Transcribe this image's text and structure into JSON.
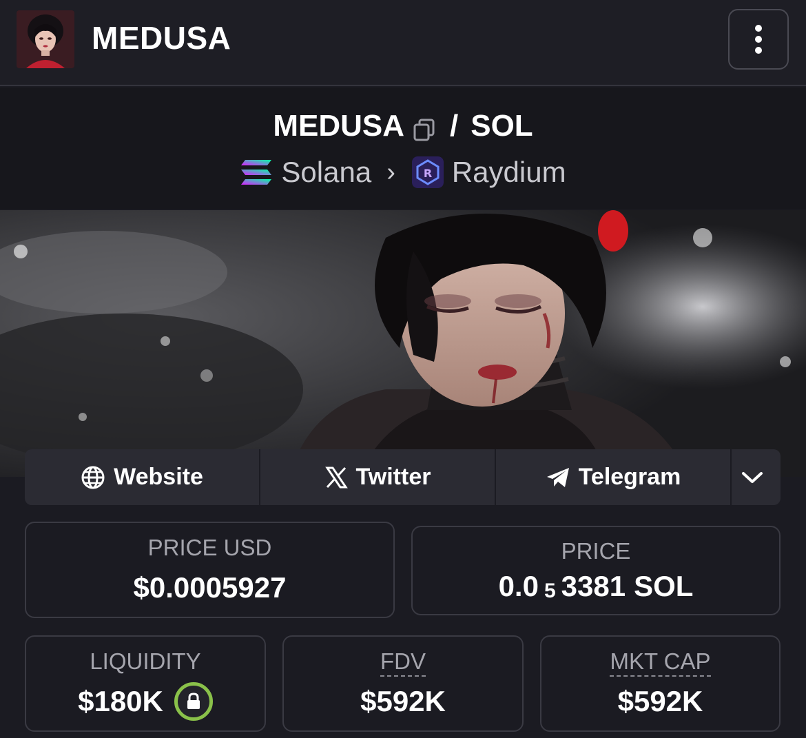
{
  "header": {
    "title": "MEDUSA",
    "avatar_icon": "token-avatar-icon",
    "menu_icon": "kebab-menu-icon"
  },
  "pair": {
    "base": "MEDUSA",
    "separator": "/",
    "quote": "SOL",
    "chain": "Solana",
    "dex": "Raydium"
  },
  "socials": {
    "website": "Website",
    "twitter": "Twitter",
    "telegram": "Telegram"
  },
  "stats": {
    "price_usd_label": "PRICE USD",
    "price_usd_value": "$0.0005927",
    "price_label": "PRICE",
    "price_prefix": "0.0",
    "price_zeros": "5",
    "price_digits": "3381",
    "price_unit": "SOL",
    "liquidity_label": "LIQUIDITY",
    "liquidity_value": "$180K",
    "fdv_label": "FDV",
    "fdv_value": "$592K",
    "mktcap_label": "MKT CAP",
    "mktcap_value": "$592K"
  },
  "colors": {
    "background": "#1b1b22",
    "lock_ring": "#8ac14a",
    "solana_gradient": [
      "#00ffa3",
      "#dc1fff"
    ],
    "raydium": "#5a3fd8"
  }
}
